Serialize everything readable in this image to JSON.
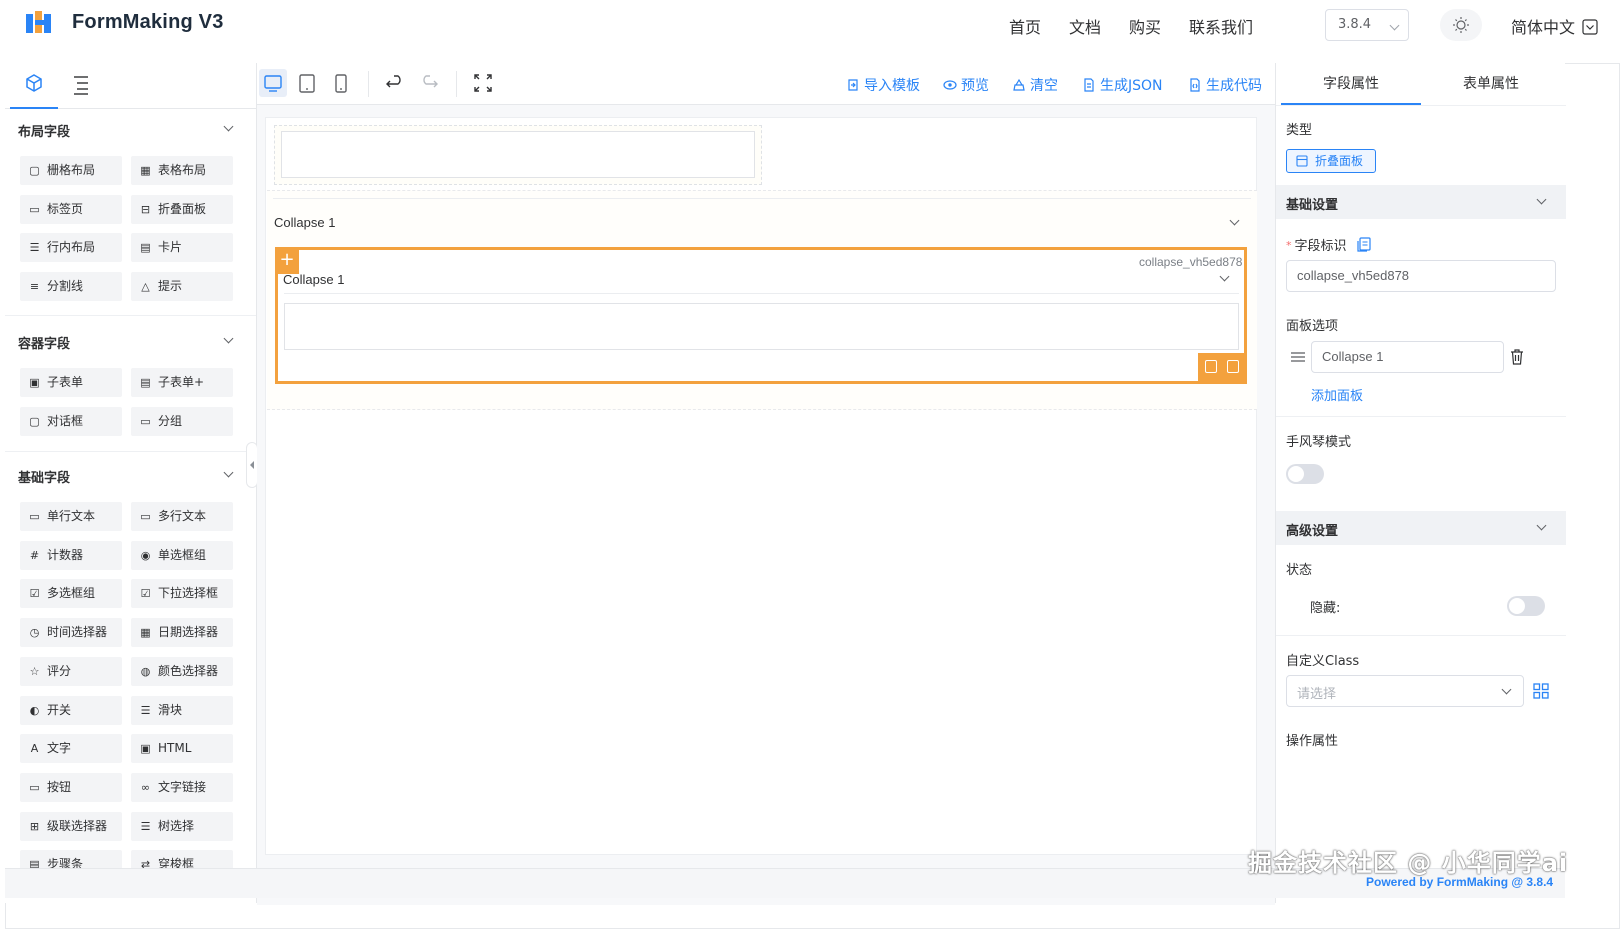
{
  "header": {
    "title": "FormMaking V3",
    "nav": [
      "首页",
      "文档",
      "购买",
      "联系我们"
    ],
    "version": "3.8.4",
    "language": "简体中文",
    "brand_color": "#2a84f6"
  },
  "left_panel": {
    "tabs": [
      "components-icon",
      "outline-icon"
    ],
    "groups": [
      {
        "title": "布局字段",
        "items": [
          {
            "label": "栅格布局",
            "icon": "grid-layout-icon"
          },
          {
            "label": "表格布局",
            "icon": "table-layout-icon"
          },
          {
            "label": "标签页",
            "icon": "tabs-icon"
          },
          {
            "label": "折叠面板",
            "icon": "collapse-icon"
          },
          {
            "label": "行内布局",
            "icon": "inline-layout-icon"
          },
          {
            "label": "卡片",
            "icon": "card-icon"
          },
          {
            "label": "分割线",
            "icon": "divider-icon"
          },
          {
            "label": "提示",
            "icon": "alert-icon"
          }
        ]
      },
      {
        "title": "容器字段",
        "items": [
          {
            "label": "子表单",
            "icon": "subform-icon"
          },
          {
            "label": "子表单+",
            "icon": "subform-plus-icon"
          },
          {
            "label": "对话框",
            "icon": "dialog-icon"
          },
          {
            "label": "分组",
            "icon": "group-icon"
          }
        ]
      },
      {
        "title": "基础字段",
        "items": [
          {
            "label": "单行文本",
            "icon": "input-icon"
          },
          {
            "label": "多行文本",
            "icon": "textarea-icon"
          },
          {
            "label": "计数器",
            "icon": "number-icon"
          },
          {
            "label": "单选框组",
            "icon": "radio-icon"
          },
          {
            "label": "多选框组",
            "icon": "checkbox-icon"
          },
          {
            "label": "下拉选择框",
            "icon": "select-icon"
          },
          {
            "label": "时间选择器",
            "icon": "clock-icon"
          },
          {
            "label": "日期选择器",
            "icon": "calendar-icon"
          },
          {
            "label": "评分",
            "icon": "star-icon"
          },
          {
            "label": "颜色选择器",
            "icon": "palette-icon"
          },
          {
            "label": "开关",
            "icon": "switch-icon"
          },
          {
            "label": "滑块",
            "icon": "slider-icon"
          },
          {
            "label": "文字",
            "icon": "text-icon"
          },
          {
            "label": "HTML",
            "icon": "html-icon"
          },
          {
            "label": "按钮",
            "icon": "button-icon"
          },
          {
            "label": "文字链接",
            "icon": "link-icon"
          },
          {
            "label": "级联选择器",
            "icon": "cascader-icon"
          },
          {
            "label": "树选择",
            "icon": "tree-icon"
          },
          {
            "label": "步骤条",
            "icon": "steps-icon"
          },
          {
            "label": "穿梭框",
            "icon": "transfer-icon"
          }
        ]
      }
    ]
  },
  "toolbar": {
    "devices": [
      "pc-icon",
      "tablet-icon",
      "mobile-icon"
    ],
    "actions": [
      {
        "label": "导入模板",
        "icon": "import-icon"
      },
      {
        "label": "预览",
        "icon": "eye-icon"
      },
      {
        "label": "清空",
        "icon": "clear-icon"
      },
      {
        "label": "生成JSON",
        "icon": "json-icon"
      },
      {
        "label": "生成代码",
        "icon": "code-icon"
      }
    ]
  },
  "canvas": {
    "outer_collapse_title": "Collapse 1",
    "selected_collapse_title": "Collapse 1",
    "selected_id": "collapse_vh5ed878",
    "selection_color": "#f3a13d"
  },
  "right_panel": {
    "tabs": [
      "字段属性",
      "表单属性"
    ],
    "type_label": "类型",
    "type_value": "折叠面板",
    "basic_section": "基础设置",
    "field_id_label": "字段标识",
    "field_id_value": "collapse_vh5ed878",
    "panel_options_label": "面板选项",
    "panel_option_value": "Collapse 1",
    "add_panel": "添加面板",
    "accordion_label": "手风琴模式",
    "advanced_section": "高级设置",
    "state_label": "状态",
    "hidden_label": "隐藏:",
    "custom_class_label": "自定义Class",
    "custom_class_placeholder": "请选择",
    "action_props_label": "操作属性"
  },
  "footer": {
    "watermark": "掘金技术社区 @ 小华同学ai",
    "powered": "Powered by FormMaking @ 3.8.4"
  }
}
